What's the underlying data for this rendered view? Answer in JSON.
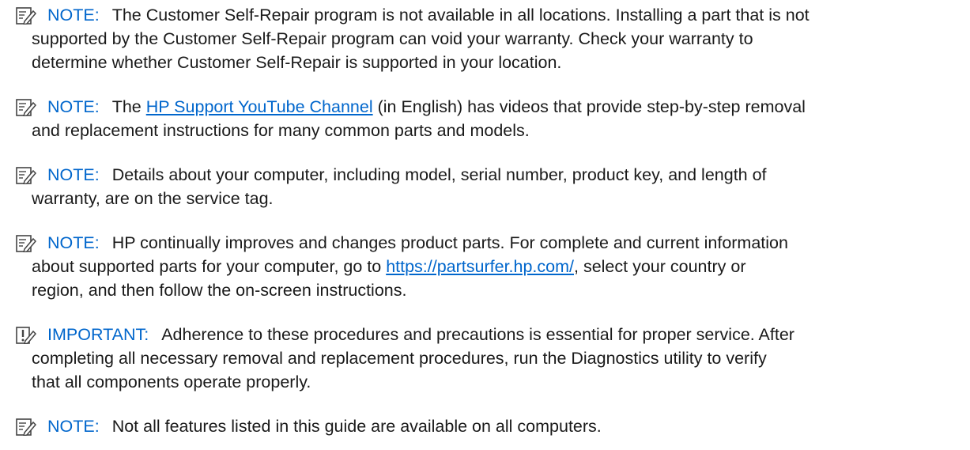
{
  "notes": [
    {
      "type": "note",
      "icon": "note-pencil-icon",
      "label": "NOTE:",
      "lines": [
        {
          "a": "The Customer Self-Repair program is not available in all locations. Installing a part that is not"
        },
        {
          "a": "supported by the Customer Self-Repair program can void your warranty. Check your warranty to"
        },
        {
          "a": "determine whether Customer Self-Repair is supported in your location."
        }
      ]
    },
    {
      "type": "note",
      "icon": "note-pencil-icon",
      "label": "NOTE:",
      "lines": [
        {
          "a": "The ",
          "link": "HP Support YouTube Channel",
          "b": " (in English) has videos that provide step-by-step removal"
        },
        {
          "a": "and replacement instructions for many common parts and models."
        }
      ]
    },
    {
      "type": "note",
      "icon": "note-pencil-icon",
      "label": "NOTE:",
      "lines": [
        {
          "a": "Details about your computer, including model, serial number, product key, and length of"
        },
        {
          "a": "warranty, are on the service tag."
        }
      ]
    },
    {
      "type": "note",
      "icon": "note-pencil-icon",
      "label": "NOTE:",
      "lines": [
        {
          "a": "HP continually improves and changes product parts. For complete and current information"
        },
        {
          "a": "about supported parts for your computer, go to ",
          "link": "https://partsurfer.hp.com/",
          "b": ", select your country or"
        },
        {
          "a": "region, and then follow the on-screen instructions."
        }
      ]
    },
    {
      "type": "important",
      "icon": "important-alert-icon",
      "label": "IMPORTANT:",
      "lines": [
        {
          "a": "Adherence to these procedures and precautions is essential for proper service. After"
        },
        {
          "a": "completing all necessary removal and replacement procedures, run the Diagnostics utility to verify"
        },
        {
          "a": "that all components operate properly."
        }
      ]
    },
    {
      "type": "note",
      "icon": "note-pencil-icon",
      "label": "NOTE:",
      "lines": [
        {
          "a": "Not all features listed in this guide are available on all computers."
        }
      ]
    }
  ],
  "colors": {
    "label": "#0066cc",
    "text": "#1a1a1a"
  }
}
